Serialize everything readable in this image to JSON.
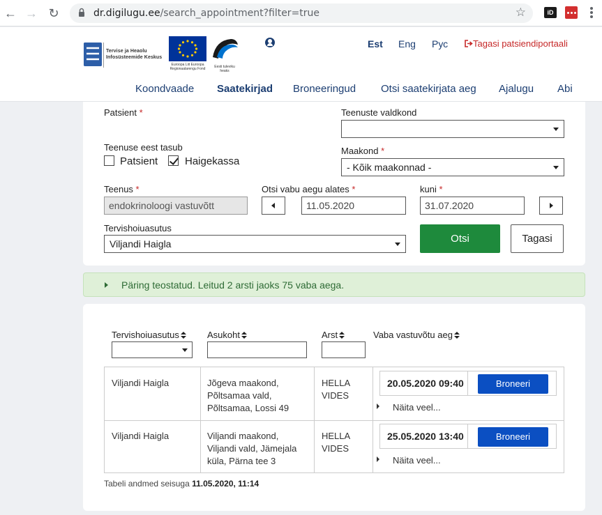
{
  "browser": {
    "url_host": "dr.digilugu.ee",
    "url_path": "/search_appointment?filter=true",
    "ext_id_label": "iD"
  },
  "header": {
    "tehik_line1": "Tervise ja Heaolu",
    "tehik_line2": "Infosüsteemide Keskus",
    "eu_caption": "Euroopa Liit Euroopa Regionaalarengu Fond",
    "ee_caption": "Eesti tuleviku heaks",
    "languages": [
      "Est",
      "Eng",
      "Рус"
    ],
    "portal_link": "Tagasi patsiendiportaali",
    "nav": [
      "Koondvaade",
      "Saatekirjad",
      "Broneeringud",
      "Otsi saatekirjata aeg",
      "Ajalugu",
      "Abi"
    ]
  },
  "search": {
    "patient_label": "Patsient",
    "service_area_label": "Teenuste valdkond",
    "service_area_value": "",
    "payer_label": "Teenuse eest tasub",
    "payer_patient": "Patsient",
    "payer_insurance": "Haigekassa",
    "county_label": "Maakond",
    "county_value": "- Kõik maakonnad -",
    "service_label": "Teenus",
    "service_value": "endokrinoloogi vastuvõtt",
    "from_label": "Otsi vabu aegu alates",
    "from_value": "11.05.2020",
    "to_label": "kuni",
    "to_value": "31.07.2020",
    "institution_label": "Tervishoiuasutus",
    "institution_value": "Viljandi Haigla",
    "search_button": "Otsi",
    "back_button": "Tagasi",
    "required_mark": "*"
  },
  "alert": {
    "text": "Päring teostatud. Leitud 2 arsti jaoks 75 vaba aega."
  },
  "results": {
    "columns": [
      "Tervishoiuasutus",
      "Asukoht",
      "Arst",
      "Vaba vastuvõtu aeg"
    ],
    "rows": [
      {
        "institution": "Viljandi Haigla",
        "location": [
          "Jõgeva maakond,",
          "Põltsamaa vald,",
          "Põltsamaa, Lossi 49"
        ],
        "doctor": [
          "HELLA",
          "VIDES"
        ],
        "slot": "20.05.2020 09:40",
        "book": "Broneeri",
        "more": "Näita veel..."
      },
      {
        "institution": "Viljandi Haigla",
        "location": [
          "Viljandi maakond,",
          "Viljandi vald, Jämejala",
          "küla, Pärna tee 3"
        ],
        "doctor": [
          "HELLA",
          "VIDES"
        ],
        "slot": "25.05.2020 13:40",
        "book": "Broneeri",
        "more": "Näita veel..."
      }
    ],
    "footnote_prefix": "Tabeli andmed seisuga",
    "footnote_time": "11.05.2020, 11:14"
  }
}
